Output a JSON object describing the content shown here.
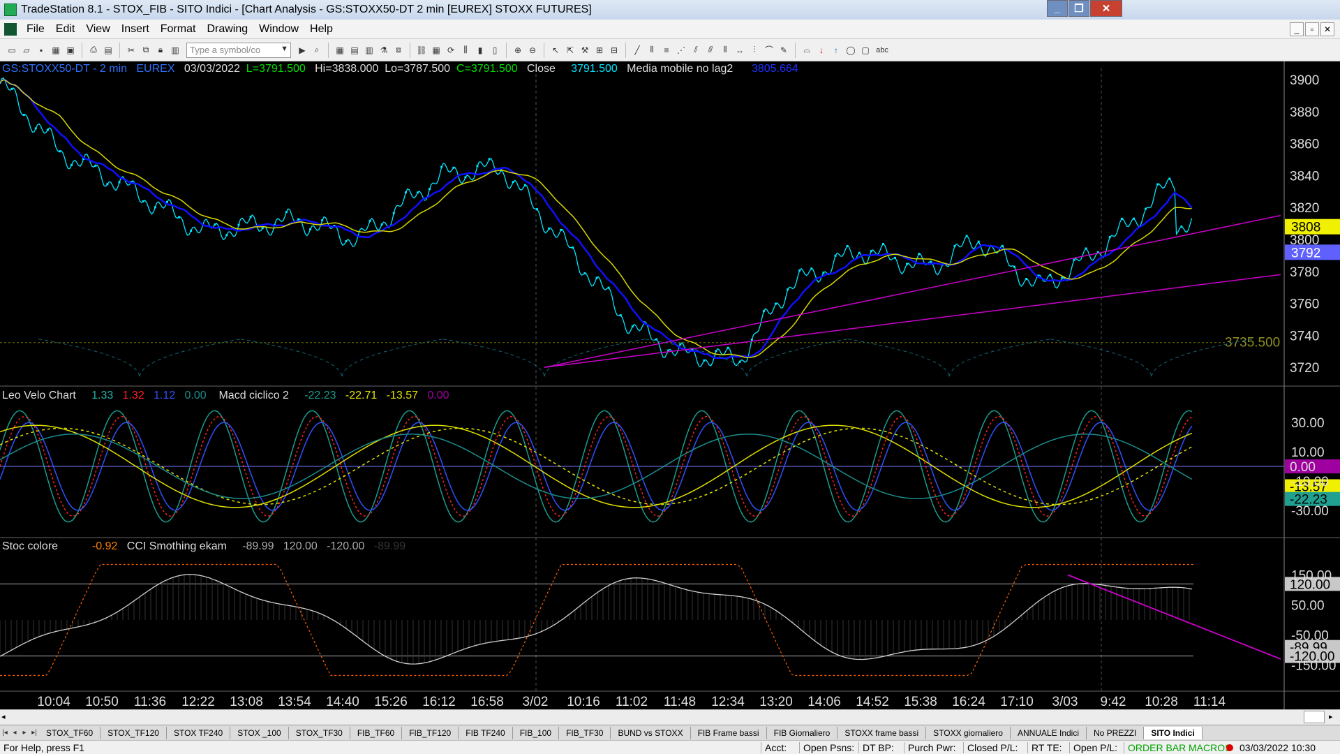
{
  "window": {
    "title": "TradeStation 8.1 - STOX_FIB - SITO Indici - [Chart Analysis - GS:STOXX50-DT  2 min  [EUREX] STOXX FUTURES]"
  },
  "menu": [
    "File",
    "Edit",
    "View",
    "Insert",
    "Format",
    "Drawing",
    "Window",
    "Help"
  ],
  "toolbar": {
    "symbol_placeholder": "Type a symbol/co",
    "text_tool": "abc"
  },
  "price_header": {
    "symbol": "GS:STOXX50-DT - 2 min",
    "exchange": "EUREX",
    "date": "03/03/2022",
    "last": "L=3791.500",
    "hi": "Hi=3838.000",
    "lo": "Lo=3787.500",
    "close_label": "C=3791.500",
    "close_word": "Close",
    "close_val": "3791.500",
    "ma_name": "Media mobile no lag2",
    "ma_val": "3805.664"
  },
  "osc_header": {
    "name": "Leo Velo Chart",
    "v1": "1.33",
    "v2": "1.32",
    "v3": "1.12",
    "v4": "0.00",
    "name2": "Macd ciclico 2",
    "v5": "-22.23",
    "v6": "-22.71",
    "v7": "-13.57",
    "v8": "0.00"
  },
  "stoc_header": {
    "name": "Stoc colore",
    "v1": "-0.92",
    "name2": "CCI Smothing ekam",
    "v2": "-89.99",
    "v3": "120.00",
    "v4": "-120.00",
    "v5": "-89.99"
  },
  "price_axis": [
    "3900",
    "3880",
    "3860",
    "3840",
    "3820",
    "3800",
    "3780",
    "3760",
    "3740",
    "3720"
  ],
  "price_tags": {
    "yellow": "3808",
    "blue": "3792",
    "level": "3735.500"
  },
  "osc_axis": [
    "30.00",
    "10.00",
    "-10.00",
    "-30.00"
  ],
  "osc_tags": {
    "magenta": "0.00",
    "yellow": "-13.57",
    "teal": "-22.23"
  },
  "stoc_axis": [
    "150.00",
    "50.00",
    "-50.00",
    "-150.00"
  ],
  "stoc_tags": {
    "upper": "120.00",
    "value": "-89.99",
    "lower": "-120.00"
  },
  "time_axis": [
    "10:04",
    "10:50",
    "11:36",
    "12:22",
    "13:08",
    "13:54",
    "14:40",
    "15:26",
    "16:12",
    "16:58",
    "3/02",
    "10:16",
    "11:02",
    "11:48",
    "12:34",
    "13:20",
    "14:06",
    "14:52",
    "15:38",
    "16:24",
    "17:10",
    "3/03",
    "9:42",
    "10:28",
    "11:14"
  ],
  "workspace_tabs": [
    "STOX_TF60",
    "STOX_TF120",
    "STOX TF240",
    "STOX _100",
    "STOX_TF30",
    "FIB_TF60",
    "FIB_TF120",
    "FIB TF240",
    "FIB_100",
    "FIB_TF30",
    "BUND vs STOXX",
    "FIB Frame bassi",
    "FIB Giornaliero",
    "STOXX frame bassi",
    "STOXX giornaliero",
    "ANNUALE Indici",
    "No PREZZI",
    "SITO Indici"
  ],
  "status": {
    "help": "For Help, press F1",
    "acct": "Acct:",
    "open_psns": "Open Psns:",
    "dt_bp": "DT BP:",
    "purch_pwr": "Purch Pwr:",
    "closed_pl": "Closed P/L:",
    "rt_te": "RT TE:",
    "open_pl": "Open P/L:",
    "order_bar": "ORDER BAR",
    "macros": "MACROS",
    "datetime": "03/03/2022 10:30"
  },
  "colors": {
    "background": "#000000",
    "price": "#00e5ff",
    "ma_fast": "#0000ff",
    "ma_slow": "#e0e000",
    "trendline": "#cc00cc",
    "red": "#ff2020",
    "grid": "#555555"
  }
}
